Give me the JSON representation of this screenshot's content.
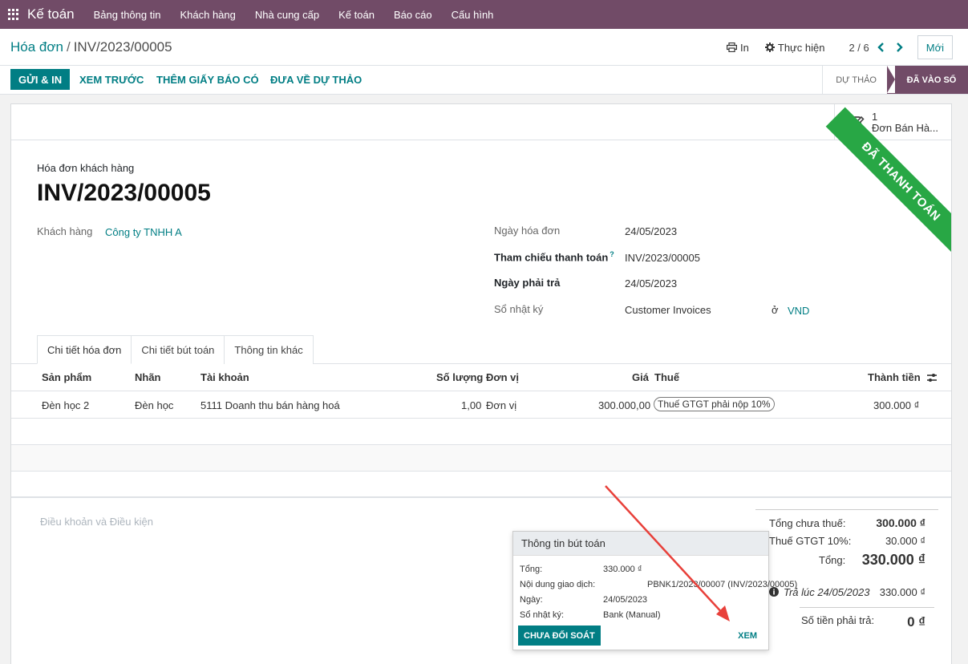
{
  "navbar": {
    "brand": "Kế toán",
    "items": [
      "Bảng thông tin",
      "Khách hàng",
      "Nhà cung cấp",
      "Kế toán",
      "Báo cáo",
      "Cấu hình"
    ]
  },
  "breadcrumb": {
    "parent": "Hóa đơn",
    "current": "INV/2023/00005"
  },
  "control": {
    "print": "In",
    "action": "Thực hiện",
    "pager": "2 / 6",
    "new": "Mới"
  },
  "statusbar": {
    "buttons": [
      "Gửi & In",
      "Xem trước",
      "Thêm giấy báo có",
      "Đưa về dự thảo"
    ],
    "stages": [
      "Dự thảo",
      "Đã vào sổ"
    ]
  },
  "smart_button": {
    "count": "1",
    "label": "Đơn Bán Hà..."
  },
  "ribbon": "Đã thanh toán",
  "doc": {
    "subtitle": "Hóa đơn khách hàng",
    "title": "INV/2023/00005"
  },
  "fields": {
    "customer_label": "Khách hàng",
    "customer": "Công ty TNHH A",
    "invoice_date_label": "Ngày hóa đơn",
    "invoice_date": "24/05/2023",
    "payment_ref_label": "Tham chiếu thanh toán",
    "payment_ref_help": "?",
    "payment_ref": "INV/2023/00005",
    "due_date_label": "Ngày phải trả",
    "due_date": "24/05/2023",
    "journal_label": "Sổ nhật ký",
    "journal": "Customer Invoices",
    "currency_prefix": "ở",
    "currency": "VND"
  },
  "tabs": [
    "Chi tiết hóa đơn",
    "Chi tiết bút toán",
    "Thông tin khác"
  ],
  "table": {
    "headers": [
      "Sản phẩm",
      "Nhãn",
      "Tài khoản",
      "Số lượng",
      "Đơn vị",
      "Giá",
      "Thuế",
      "Thành tiền"
    ],
    "rows": [
      {
        "product": "Đèn học 2",
        "label": "Đèn học",
        "account": "5111 Doanh thu bán hàng hoá",
        "qty": "1,00",
        "uom": "Đơn vị",
        "price": "300.000,00",
        "tax": "Thuế GTGT phải nộp 10%",
        "subtotal": "300.000 ₫"
      }
    ]
  },
  "terms": "Điều khoản và Điều kiện",
  "totals": {
    "untaxed_label": "Tổng chưa thuế:",
    "untaxed": "300.000 ₫",
    "tax_label": "Thuế GTGT 10%:",
    "tax": "30.000 ₫",
    "total_label": "Tổng:",
    "total": "330.000 ₫",
    "paid_label": "Trả lúc 24/05/2023",
    "paid": "330.000 ₫",
    "residual_label": "Số tiền phải trả:",
    "residual": "0 ₫"
  },
  "popover": {
    "title": "Thông tin bút toán",
    "amount_label": "Tổng:",
    "amount": "330.000 ₫",
    "memo_label": "Nội dung giao dịch:",
    "memo": "PBNK1/2023/00007 (INV/2023/00005)",
    "date_label": "Ngày:",
    "date": "24/05/2023",
    "journal_label": "Sổ nhật ký:",
    "journal": "Bank (Manual)",
    "unreconcile": "Chưa đối soát",
    "view": "Xem"
  },
  "colors": {
    "brand": "#714B67",
    "accent": "#017e84",
    "paid_ribbon": "#28a745",
    "annotation_arrow": "#e8403a"
  }
}
